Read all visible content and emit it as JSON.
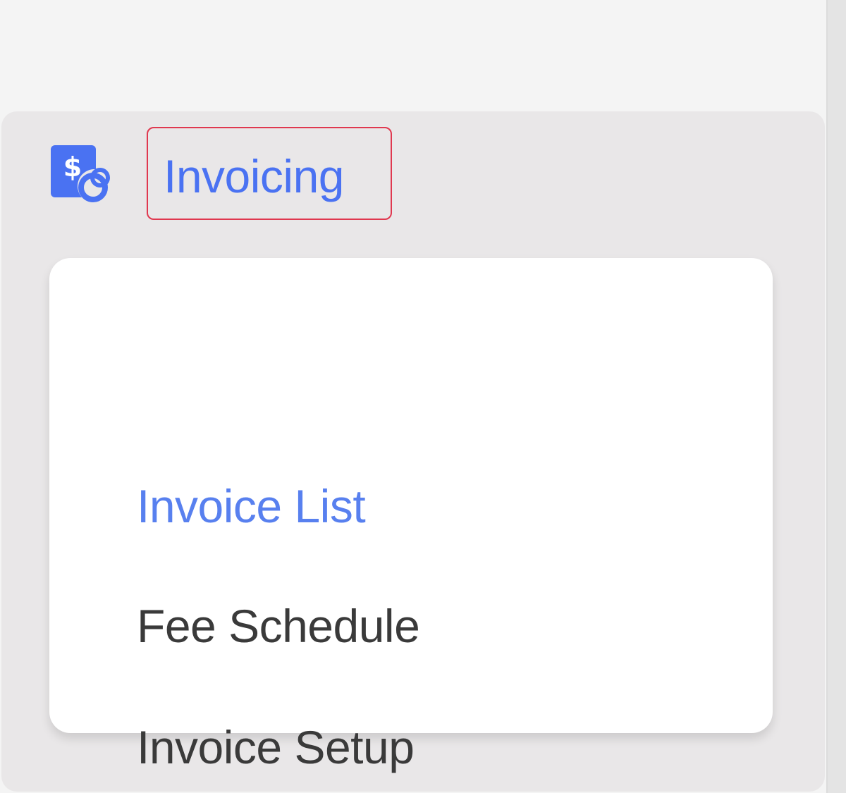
{
  "nav": {
    "section": {
      "icon": "invoice-dollar-icon",
      "title": "Invoicing"
    },
    "items": [
      {
        "label": "Invoice List",
        "active": true
      },
      {
        "label": "Fee Schedule",
        "active": false
      },
      {
        "label": "Invoice Setup",
        "active": false
      }
    ]
  },
  "colors": {
    "accent": "#4a72f2",
    "active_item": "#5880ef",
    "text": "#3a3a3a",
    "highlight_border": "#e0384f",
    "panel_bg": "#e9e7e8",
    "card_bg": "#ffffff"
  }
}
